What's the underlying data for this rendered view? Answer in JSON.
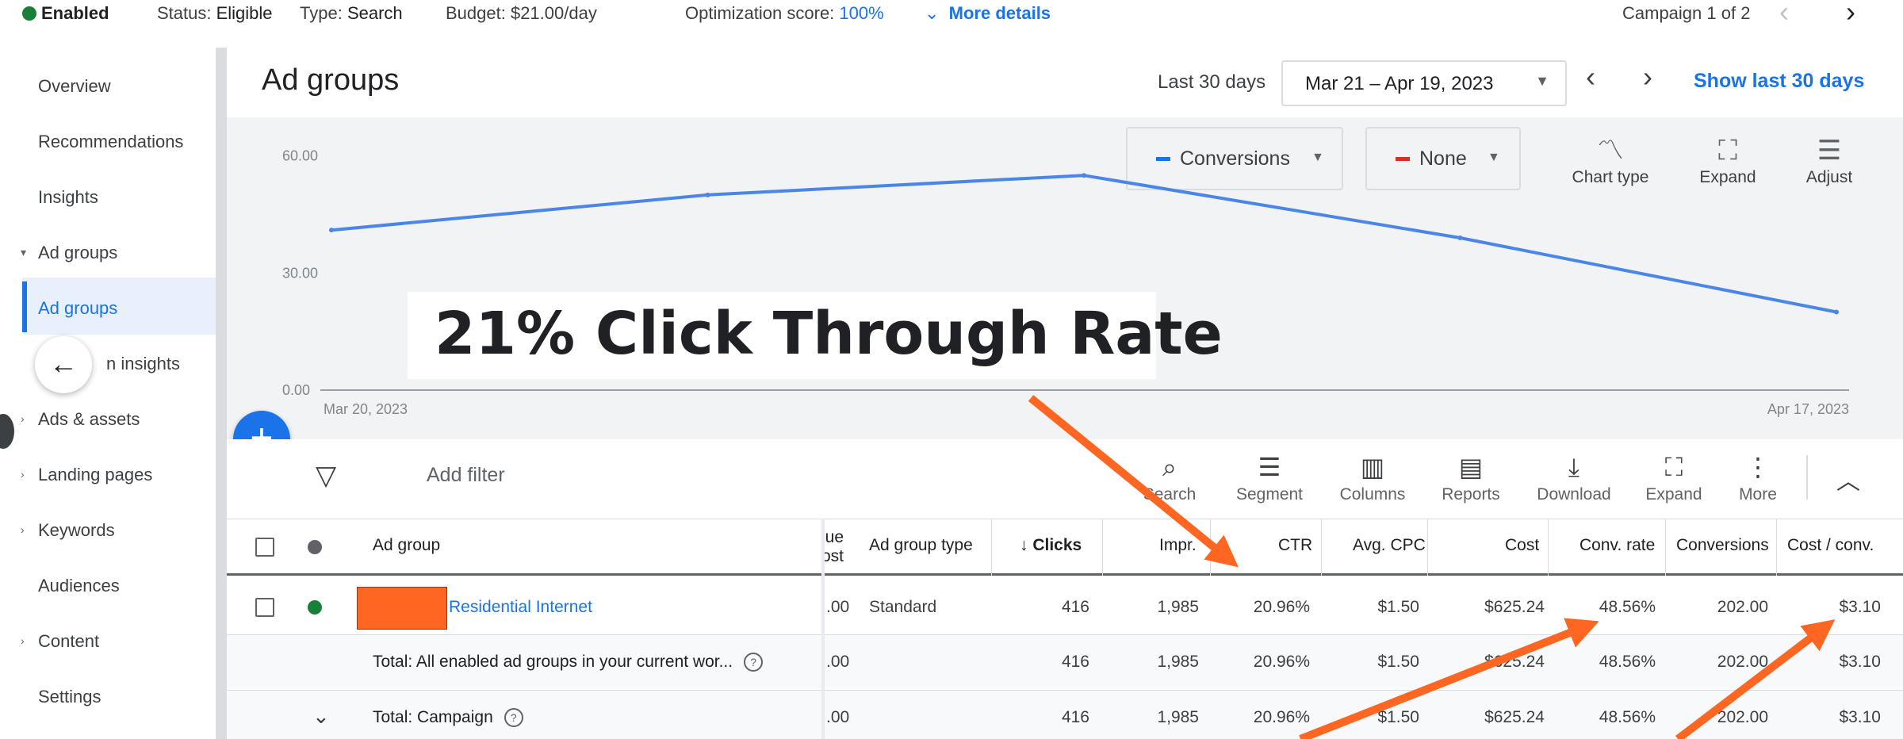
{
  "top_bar": {
    "status_enabled": "Enabled",
    "status_label": "Status:",
    "status_value": "Eligible",
    "type_label": "Type:",
    "type_value": "Search",
    "budget": "Budget: $21.00/day",
    "opt_label": "Optimization score:",
    "opt_value": "100%",
    "more_details": "More details",
    "campaign_counter": "Campaign 1 of 2"
  },
  "sidebar": {
    "items": [
      {
        "label": "Overview"
      },
      {
        "label": "Recommendations"
      },
      {
        "label": "Insights"
      },
      {
        "label": "Ad groups"
      },
      {
        "label": "Ad groups"
      },
      {
        "label": "n insights"
      },
      {
        "label": "Ads & assets"
      },
      {
        "label": "Landing pages"
      },
      {
        "label": "Keywords"
      },
      {
        "label": "Audiences"
      },
      {
        "label": "Content"
      },
      {
        "label": "Settings"
      }
    ]
  },
  "header": {
    "title": "Ad groups",
    "range_label": "Last 30 days",
    "date_range": "Mar 21 – Apr 19, 2023",
    "show_last": "Show last 30 days"
  },
  "chart_controls": {
    "metric1": "Conversions",
    "metric2": "None",
    "chart_type": "Chart type",
    "expand": "Expand",
    "adjust": "Adjust"
  },
  "chart_data": {
    "type": "line",
    "x": [
      "Mar 20, 2023",
      "Mar 27, 2023",
      "Apr 3, 2023",
      "Apr 10, 2023",
      "Apr 17, 2023"
    ],
    "series": [
      {
        "values": [
          41,
          50,
          55,
          39,
          20
        ]
      }
    ],
    "yticks": [
      "60.00",
      "30.00",
      "0.00"
    ],
    "xtick_labels": [
      "Mar 20, 2023",
      "Apr 17, 2023"
    ],
    "ylim": [
      0,
      65
    ],
    "color": "#4a86e8"
  },
  "overlay": {
    "banner": "21% Click Through Rate",
    "arrow_color": "#ff6622"
  },
  "toolbar": {
    "add_filter": "Add filter",
    "tools": [
      {
        "label": "Search",
        "icon": "search-icon"
      },
      {
        "label": "Segment",
        "icon": "segment-icon"
      },
      {
        "label": "Columns",
        "icon": "columns-icon"
      },
      {
        "label": "Reports",
        "icon": "reports-icon"
      },
      {
        "label": "Download",
        "icon": "download-icon"
      },
      {
        "label": "Expand",
        "icon": "expand-icon"
      },
      {
        "label": "More",
        "icon": "more-icon"
      }
    ]
  },
  "table": {
    "headers": {
      "ad_group": "Ad group",
      "value_cost_1": "lue",
      "value_cost_2": "ost",
      "ad_group_type": "Ad group type",
      "clicks": "↓ Clicks",
      "impr": "Impr.",
      "ctr": "CTR",
      "avg_cpc": "Avg. CPC",
      "cost": "Cost",
      "conv_rate": "Conv. rate",
      "conversions": "Conversions",
      "cost_conv": "Cost / conv."
    },
    "rows": [
      {
        "name": "Residential Internet",
        "value_cost": ".00",
        "type": "Standard",
        "clicks": "416",
        "impr": "1,985",
        "ctr": "20.96%",
        "avg_cpc": "$1.50",
        "cost": "$625.24",
        "conv_rate": "48.56%",
        "conversions": "202.00",
        "cost_conv": "$3.10"
      },
      {
        "name": "Total: All enabled ad groups in your current wor...",
        "value_cost": ".00",
        "type": "",
        "clicks": "416",
        "impr": "1,985",
        "ctr": "20.96%",
        "avg_cpc": "$1.50",
        "cost": "$625.24",
        "conv_rate": "48.56%",
        "conversions": "202.00",
        "cost_conv": "$3.10"
      },
      {
        "name": "Total: Campaign",
        "value_cost": ".00",
        "type": "",
        "clicks": "416",
        "impr": "1,985",
        "ctr": "20.96%",
        "avg_cpc": "$1.50",
        "cost": "$625.24",
        "conv_rate": "48.56%",
        "conversions": "202.00",
        "cost_conv": "$3.10"
      }
    ]
  }
}
